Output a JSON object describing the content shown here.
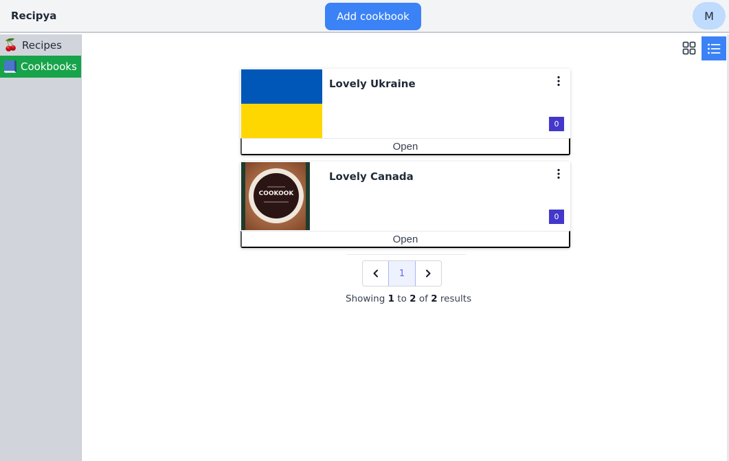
{
  "header": {
    "brand": "Recipya",
    "add_button": "Add cookbook",
    "avatar_initial": "M"
  },
  "sidebar": {
    "items": [
      {
        "label": "Recipes",
        "icon": "cherries-icon",
        "active": false
      },
      {
        "label": "Cookbooks",
        "icon": "blue-book-icon",
        "active": true
      }
    ]
  },
  "view_toggle": {
    "grid_icon": "grid-view-icon",
    "list_icon": "list-view-icon",
    "active": "list"
  },
  "cookbooks": [
    {
      "title": "Lovely Ukraine",
      "recipe_count": "0",
      "action": "Open",
      "image": "ukraine-flag"
    },
    {
      "title": "Lovely Canada",
      "recipe_count": "0",
      "action": "Open",
      "image": "cookbook-cover"
    }
  ],
  "pagination": {
    "current_page": "1",
    "showing_prefix": "Showing",
    "from": "1",
    "to_word": "to",
    "to": "2",
    "of_word": "of",
    "total": "2",
    "suffix": "results"
  },
  "colors": {
    "accent": "#3b82f6",
    "active_nav": "#16a34a",
    "badge": "#4338ca",
    "sidebar_bg": "#d1d5db",
    "topbar_bg": "#f3f4f6",
    "ukraine_blue": "#0057b7",
    "ukraine_yellow": "#ffd700"
  }
}
